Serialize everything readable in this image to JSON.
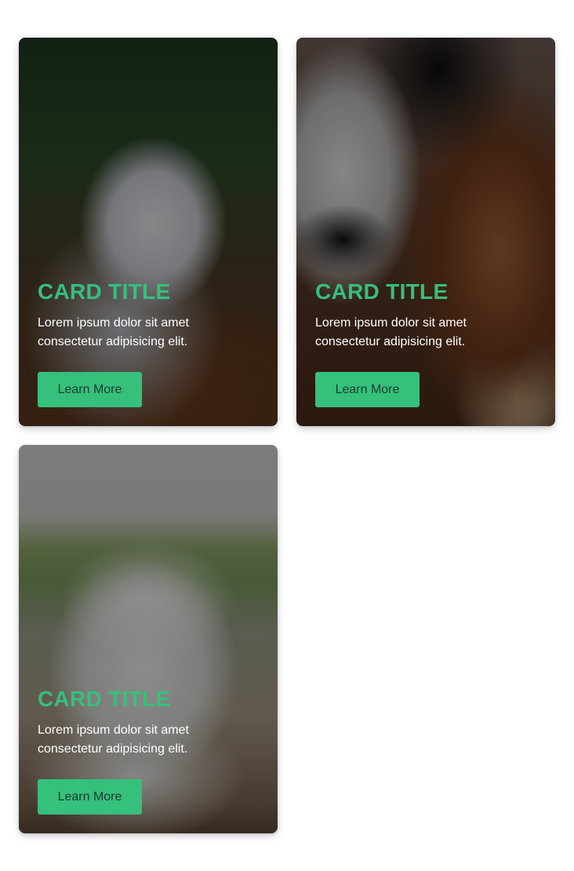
{
  "theme": {
    "accent": "#35c07c",
    "button_text": "#1d3a2e",
    "text": "#ffffff"
  },
  "cards": [
    {
      "image": "husky-puppy-photo",
      "title": "CARD TITLE",
      "description": "Lorem ipsum dolor sit amet consectetur adipisicing elit.",
      "button_label": "Learn More"
    },
    {
      "image": "two-dogs-photo",
      "title": "CARD TITLE",
      "description": "Lorem ipsum dolor sit amet consectetur adipisicing elit.",
      "button_label": "Learn More"
    },
    {
      "image": "white-puppy-photo",
      "title": "CARD TITLE",
      "description": "Lorem ipsum dolor sit amet consectetur adipisicing elit.",
      "button_label": "Learn More"
    }
  ]
}
